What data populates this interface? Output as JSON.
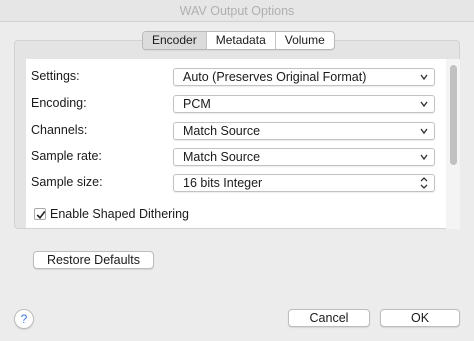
{
  "window": {
    "title": "WAV Output Options"
  },
  "tabs": [
    {
      "label": "Encoder",
      "active": true
    },
    {
      "label": "Metadata",
      "active": false
    },
    {
      "label": "Volume",
      "active": false
    }
  ],
  "settings": {
    "rows": [
      {
        "label": "Settings:",
        "value": "Auto (Preserves Original Format)"
      },
      {
        "label": "Encoding:",
        "value": "PCM"
      },
      {
        "label": "Channels:",
        "value": "Match Source"
      },
      {
        "label": "Sample rate:",
        "value": "Match Source"
      },
      {
        "label": "Sample size:",
        "value": "16 bits Integer"
      }
    ]
  },
  "dithering": {
    "label": "Enable Shaped Dithering",
    "checked": true
  },
  "buttons": {
    "restore": "Restore Defaults",
    "cancel": "Cancel",
    "ok": "OK",
    "help": "?"
  },
  "icons": {
    "select_arrow": "chevron-updown-icon",
    "checkmark": "checkmark-icon",
    "help": "help-icon"
  }
}
